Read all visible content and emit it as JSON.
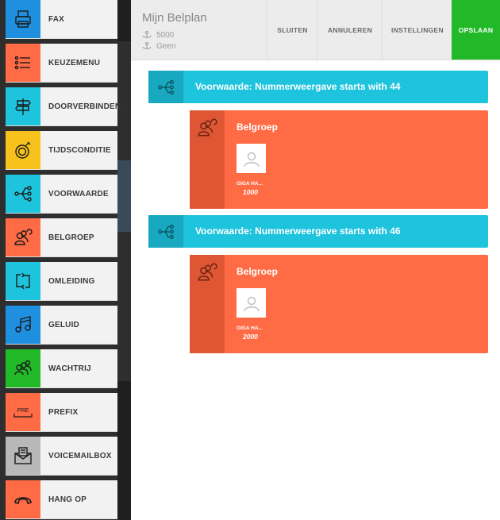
{
  "sidebar": {
    "items": [
      {
        "label": "FAX",
        "icon": "fax-icon",
        "color": "#1f8fe0"
      },
      {
        "label": "KEUZEMENU",
        "icon": "menu-list-icon",
        "color": "#fe6b45"
      },
      {
        "label": "DOORVERBINDEN",
        "icon": "signpost-icon",
        "color": "#1ec3dd"
      },
      {
        "label": "TIJDSCONDITIE",
        "icon": "stopwatch-icon",
        "color": "#f7c21b"
      },
      {
        "label": "VOORWAARDE",
        "icon": "branch-icon",
        "color": "#1ec3dd"
      },
      {
        "label": "BELGROEP",
        "icon": "group-icon",
        "color": "#fe6b45"
      },
      {
        "label": "OMLEIDING",
        "icon": "redirect-icon",
        "color": "#1ec3dd"
      },
      {
        "label": "GELUID",
        "icon": "music-icon",
        "color": "#1f8fe0"
      },
      {
        "label": "WACHTRIJ",
        "icon": "queue-icon",
        "color": "#22b928"
      },
      {
        "label": "PREFIX",
        "icon": "prefix-icon",
        "color": "#fe6b45"
      },
      {
        "label": "VOICEMAILBOX",
        "icon": "envelope-icon",
        "color": "#b8b8b8"
      },
      {
        "label": "HANG OP",
        "icon": "hangup-icon",
        "color": "#fe6b45"
      }
    ]
  },
  "header": {
    "title": "Mijn Belplan",
    "number": "5000",
    "fallback": "Geen",
    "buttons": {
      "close": "SLUITEN",
      "cancel": "ANNULEREN",
      "settings": "INSTELLINGEN",
      "save": "OPSLAAN"
    },
    "save_color": "#22b928"
  },
  "flow": [
    {
      "condition": "Voorwaarde: Nummerweergave  starts with  44",
      "ring_group": {
        "title": "Belgroep",
        "user_name": "GIGA HA...",
        "user_number": "1000"
      }
    },
    {
      "condition": "Voorwaarde: Nummerweergave  starts with  46",
      "ring_group": {
        "title": "Belgroep",
        "user_name": "GIGA HA...",
        "user_number": "2000"
      }
    }
  ]
}
